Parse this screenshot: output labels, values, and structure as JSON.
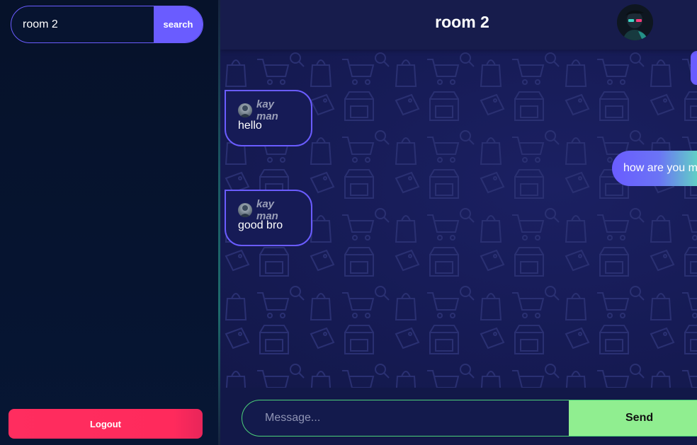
{
  "sidebar": {
    "search": {
      "value": "room 2",
      "placeholder": "",
      "button_label": "search"
    },
    "logout_label": "Logout"
  },
  "chat": {
    "title": "room 2",
    "messages_received": [
      {
        "sender": "kay man",
        "text": "hello"
      },
      {
        "sender": "kay man",
        "text": "good bro"
      }
    ],
    "messages_sent": [
      {
        "text": ""
      },
      {
        "text": "how are you man"
      }
    ],
    "composer": {
      "placeholder": "Message...",
      "send_label": "Send"
    }
  },
  "colors": {
    "accent": "#6a5cff",
    "logout": "#ff2a5c",
    "send": "#90ee90",
    "composer_border": "#4cd07a",
    "sent_gradient_end": "#61cfc6"
  },
  "icons": {
    "header_avatar": "user-avatar-icon",
    "message_avatar": "user-avatar-icon",
    "background_pattern": "shopping-pattern"
  }
}
